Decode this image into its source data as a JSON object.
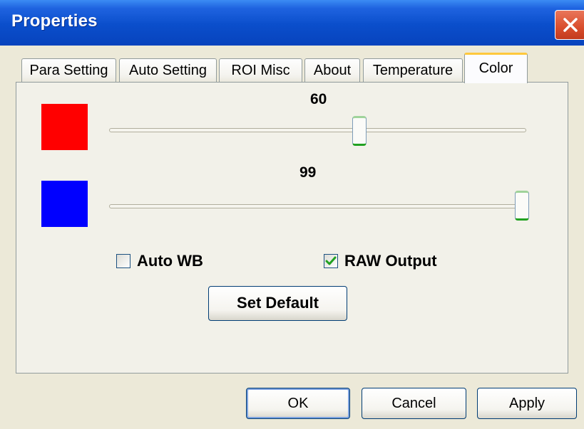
{
  "window": {
    "title": "Properties"
  },
  "tabs": [
    {
      "label": "Para Setting"
    },
    {
      "label": "Auto Setting"
    },
    {
      "label": "ROI  Misc"
    },
    {
      "label": "About"
    },
    {
      "label": "Temperature"
    },
    {
      "label": "Color",
      "active": true
    }
  ],
  "sliders": {
    "red": {
      "value": "60",
      "swatch_color": "#ff0000",
      "fraction": 0.6
    },
    "blue": {
      "value": "99",
      "swatch_color": "#0000ff",
      "fraction": 0.99
    }
  },
  "checkboxes": {
    "auto_wb": {
      "label": "Auto WB",
      "checked": false
    },
    "raw_output": {
      "label": "RAW Output",
      "checked": true
    }
  },
  "buttons": {
    "set_default": "Set Default",
    "ok": "OK",
    "cancel": "Cancel",
    "apply": "Apply"
  },
  "colors": {
    "titlebar": "#0a4ecb",
    "close_button": "#d94d2c",
    "check_mark": "#21a121"
  },
  "icons": {
    "close": "close-icon",
    "check": "check-mark-icon"
  }
}
